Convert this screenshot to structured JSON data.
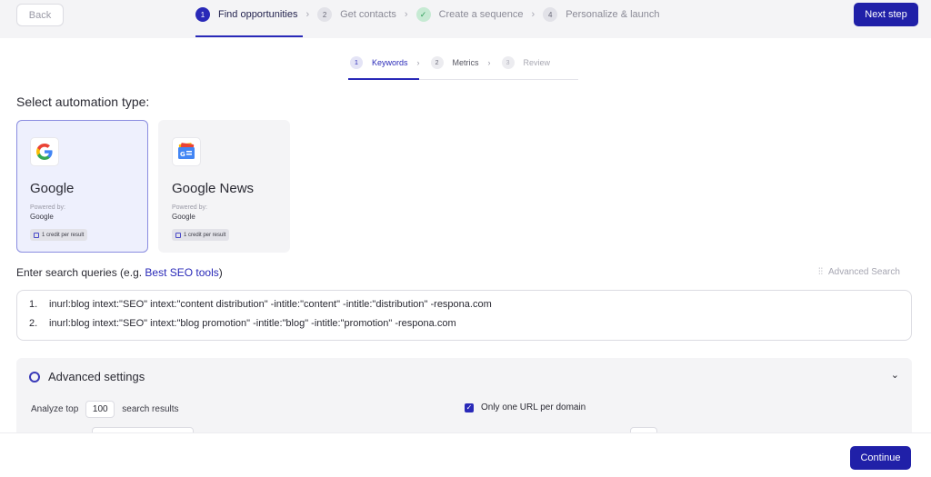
{
  "topbar": {
    "back_label": "Back",
    "steps": [
      {
        "num": "1",
        "label": "Find opportunities"
      },
      {
        "num": "2",
        "label": "Get contacts"
      },
      {
        "num": "✓",
        "label": "Create a sequence"
      },
      {
        "num": "4",
        "label": "Personalize & launch"
      }
    ],
    "next_label": "Next step"
  },
  "substeps": [
    {
      "num": "1",
      "label": "Keywords"
    },
    {
      "num": "2",
      "label": "Metrics"
    },
    {
      "num": "3",
      "label": "Review"
    }
  ],
  "automation": {
    "title": "Select automation type:",
    "cards": [
      {
        "name": "Google",
        "powered_by_label": "Powered by:",
        "powered_by": "Google",
        "credit": "1 credit per result"
      },
      {
        "name": "Google News",
        "powered_by_label": "Powered by:",
        "powered_by": "Google",
        "credit": "1 credit per result"
      }
    ]
  },
  "queries": {
    "label_prefix": "Enter search queries (e.g. ",
    "label_link": "Best SEO tools",
    "label_suffix": ")",
    "advanced_search": "Advanced Search",
    "lines": [
      {
        "n": "1.",
        "text": "inurl:blog intext:\"SEO\" intext:\"content distribution\" -intitle:\"content\" -intitle:\"distribution\" -respona.com"
      },
      {
        "n": "2.",
        "text": "inurl:blog intext:\"SEO\" intext:\"blog promotion\" -intitle:\"blog\" -intitle:\"promotion\" -respona.com"
      }
    ]
  },
  "advanced": {
    "title": "Advanced settings",
    "analyze_prefix": "Analyze top",
    "analyze_value": "100",
    "analyze_suffix": "search results",
    "one_url_label": "Only one URL per domain"
  },
  "footer": {
    "continue_label": "Continue"
  },
  "colors": {
    "accent": "#2020a8",
    "selected_card_bg": "#eef0fd",
    "done_step": "#c6ead3"
  }
}
